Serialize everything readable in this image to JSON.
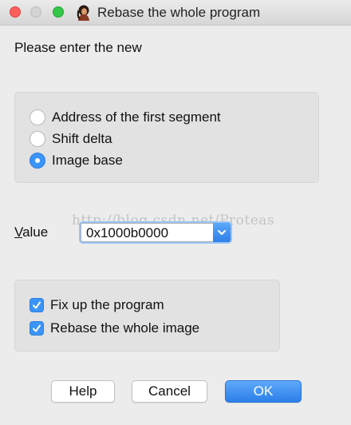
{
  "window": {
    "title": "Rebase the whole program"
  },
  "prompt": "Please enter the new",
  "rebase_options": [
    {
      "label": "Address of the first segment",
      "selected": false
    },
    {
      "label": "Shift delta",
      "selected": false
    },
    {
      "label": "Image base",
      "selected": true
    }
  ],
  "value": {
    "label_first": "V",
    "label_rest": "alue",
    "current": "0x1000b0000"
  },
  "watermark": "http://blog.csdn.net/Proteas",
  "checkboxes": [
    {
      "label": "Fix up the program",
      "checked": true
    },
    {
      "label": "Rebase the whole image",
      "checked": true
    }
  ],
  "buttons": {
    "help": "Help",
    "cancel": "Cancel",
    "ok": "OK"
  },
  "colors": {
    "accent": "#3b94f7",
    "close": "#fc605c",
    "maximize": "#34c84a"
  }
}
